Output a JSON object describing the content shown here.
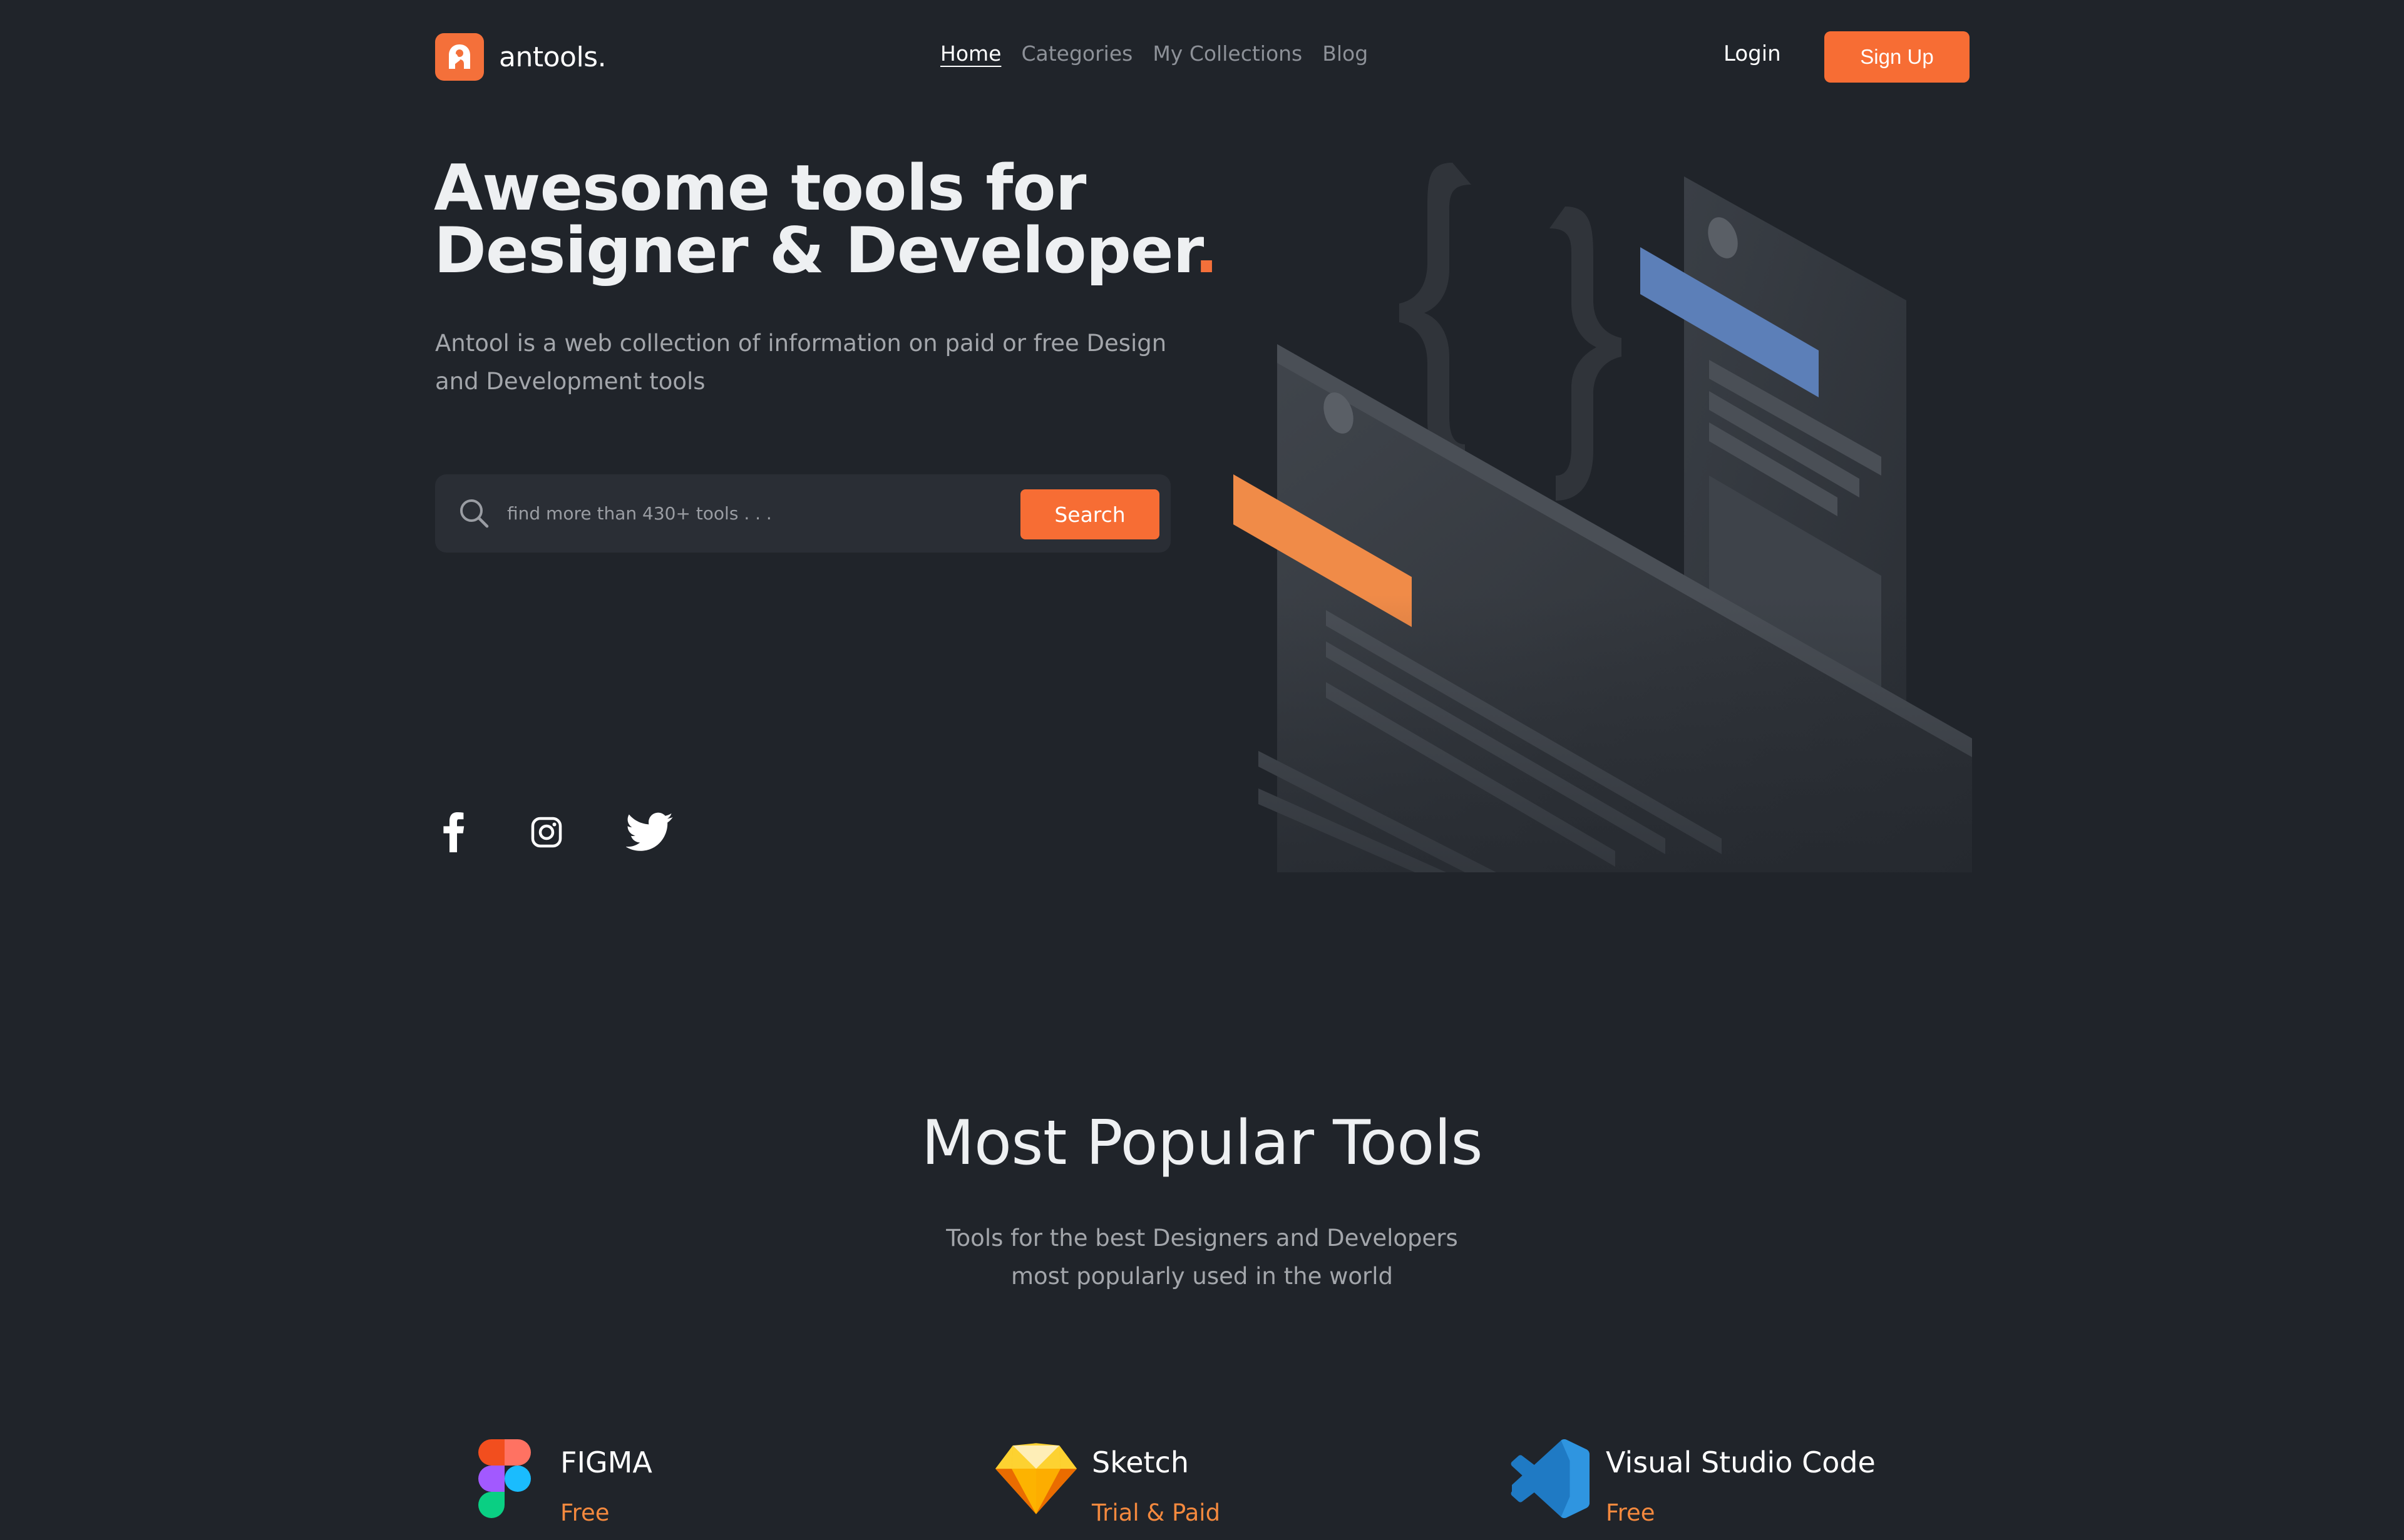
{
  "header": {
    "logo_text": "antools.",
    "nav": [
      {
        "label": "Home",
        "active": true
      },
      {
        "label": "Categories",
        "active": false
      },
      {
        "label": "My Collections",
        "active": false
      },
      {
        "label": "Blog",
        "active": false
      }
    ],
    "login_label": "Login",
    "signup_label": "Sign Up"
  },
  "hero": {
    "title_line1": "Awesome tools for",
    "title_line2": "Designer & Developer",
    "title_dot": ".",
    "subtitle": "Antool is a web collection of information on paid or free Design and Development tools",
    "search": {
      "placeholder": "find more than 430+ tools . . .",
      "button_label": "Search"
    },
    "social_icons": [
      "facebook-icon",
      "instagram-icon",
      "twitter-icon"
    ]
  },
  "popular": {
    "title": "Most Popular Tools",
    "subtitle_line1": "Tools for the best Designers and Developers",
    "subtitle_line2": "most popularly used in the world",
    "tools": [
      {
        "name": "FIGMA",
        "price": "Free",
        "icon": "figma-icon"
      },
      {
        "name": "Sketch",
        "price": "Trial & Paid",
        "icon": "sketch-icon"
      },
      {
        "name": "Visual Studio Code",
        "price": "Free",
        "icon": "vscode-icon"
      }
    ]
  },
  "colors": {
    "background": "#20242a",
    "accent": "#f76d34",
    "price": "#f4893e",
    "illustration_blue": "#5c7fb8"
  }
}
